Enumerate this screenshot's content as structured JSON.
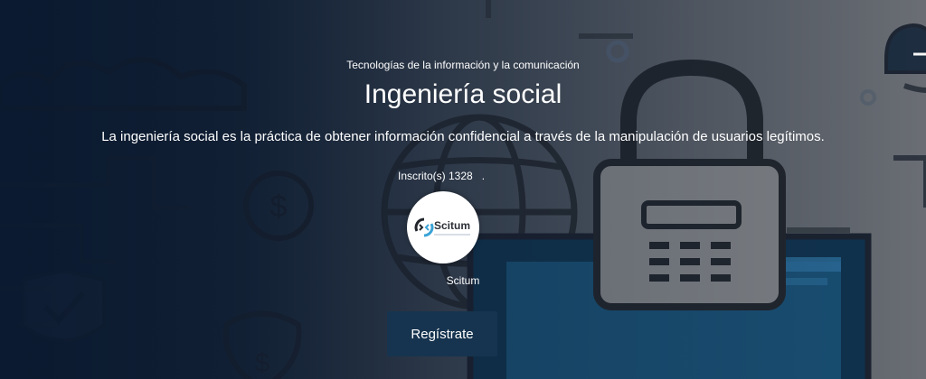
{
  "course": {
    "category": "Tecnologías de la información y la comunicación",
    "title": "Ingeniería social",
    "description": "La ingeniería social es la práctica de obtener información confidencial a través de la manipulación de usuarios legítimos.",
    "enrolled_label": "Inscrito(s) 1328",
    "enrolled_trailing": ".",
    "provider_logo_text": "Scitum",
    "provider_name": "Scitum",
    "register_label": "Regístrate"
  },
  "background_icons": [
    "cloud-icon",
    "dollar-coin-icon",
    "globe-icon",
    "padlock-icon",
    "shield-dollar-icon",
    "laptop-icon",
    "key-icon",
    "user-icon"
  ],
  "colors": {
    "button_bg": "#16344f",
    "text": "#ffffff",
    "bg_left": "#0b1a30",
    "bg_right": "#6a6e74"
  }
}
